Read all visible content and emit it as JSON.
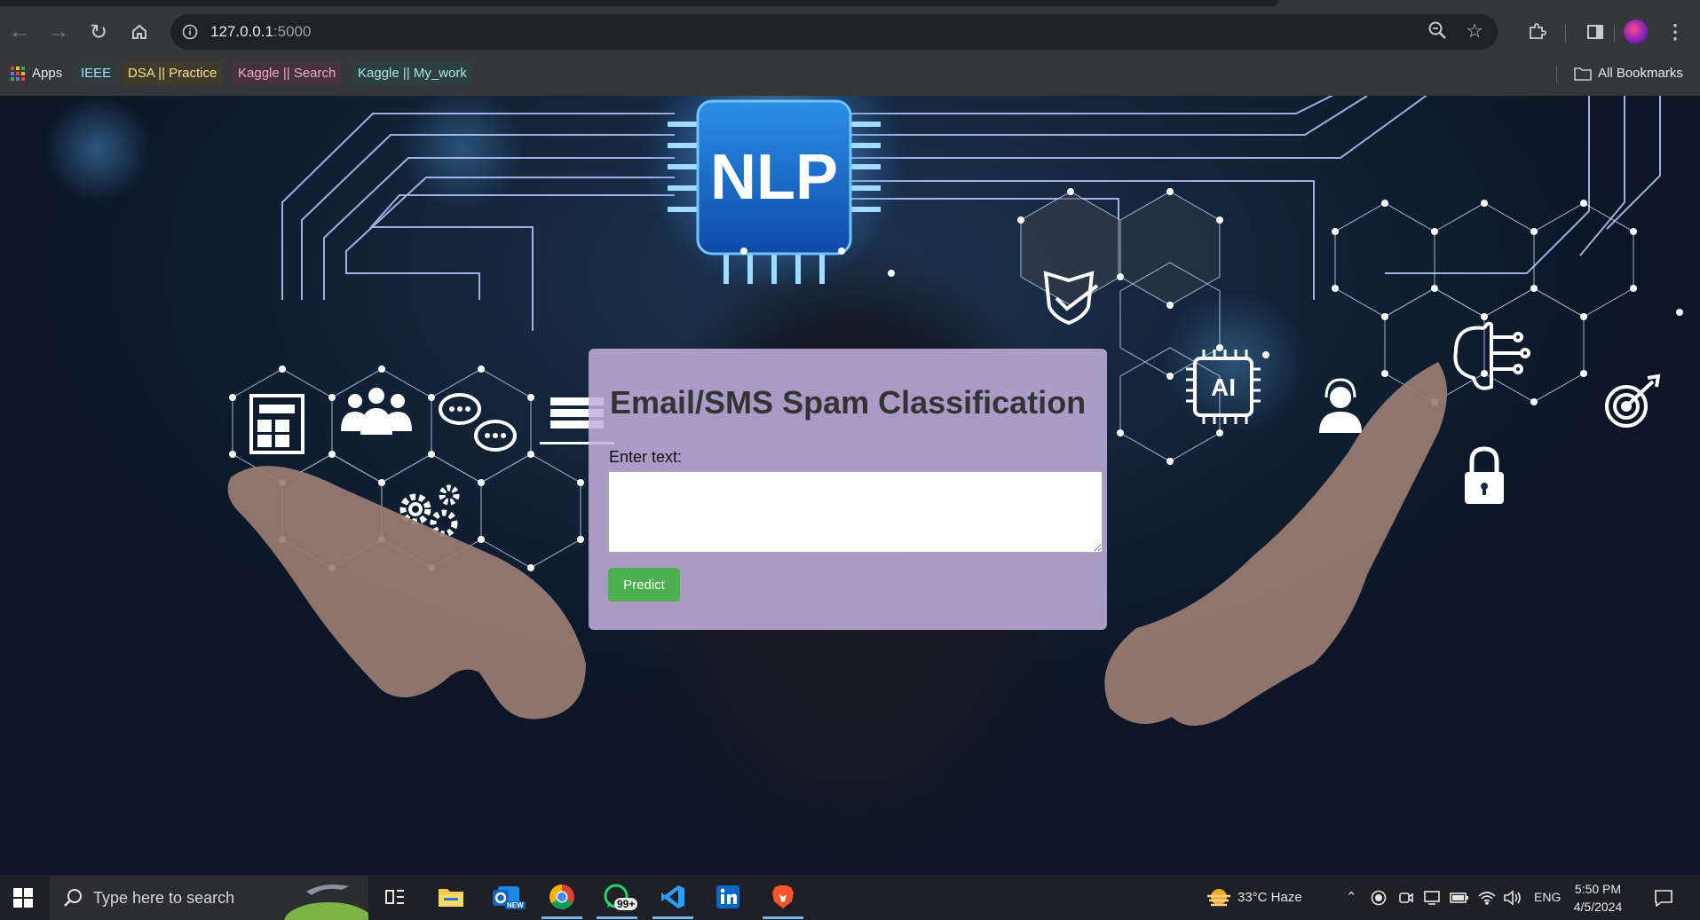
{
  "browser": {
    "url_host": "127.0.0.1",
    "url_port": ":5000",
    "bookmarks": [
      {
        "label": "Apps",
        "icon": "apps-grid-icon"
      },
      {
        "label": "IEEE",
        "color": "#9fe6f2"
      },
      {
        "label": "DSA || Practice",
        "color": "#f6e08a"
      },
      {
        "label": "Kaggle || Search",
        "color": "#f3a7c9"
      },
      {
        "label": "Kaggle || My_work",
        "color": "#a9e6e3"
      }
    ],
    "all_bookmarks_label": "All Bookmarks"
  },
  "background": {
    "chip_label": "NLP",
    "ai_label": "AI"
  },
  "form": {
    "title": "Email/SMS Spam Classification",
    "label": "Enter text:",
    "textarea_value": "",
    "button_label": "Predict",
    "button_color": "#4caf50"
  },
  "taskbar": {
    "search_placeholder": "Type here to search",
    "whatsapp_badge": "99+",
    "outlook_badge": "NEW",
    "weather": "33°C  Haze",
    "language": "ENG",
    "time": "5:50 PM",
    "date": "4/5/2024"
  }
}
